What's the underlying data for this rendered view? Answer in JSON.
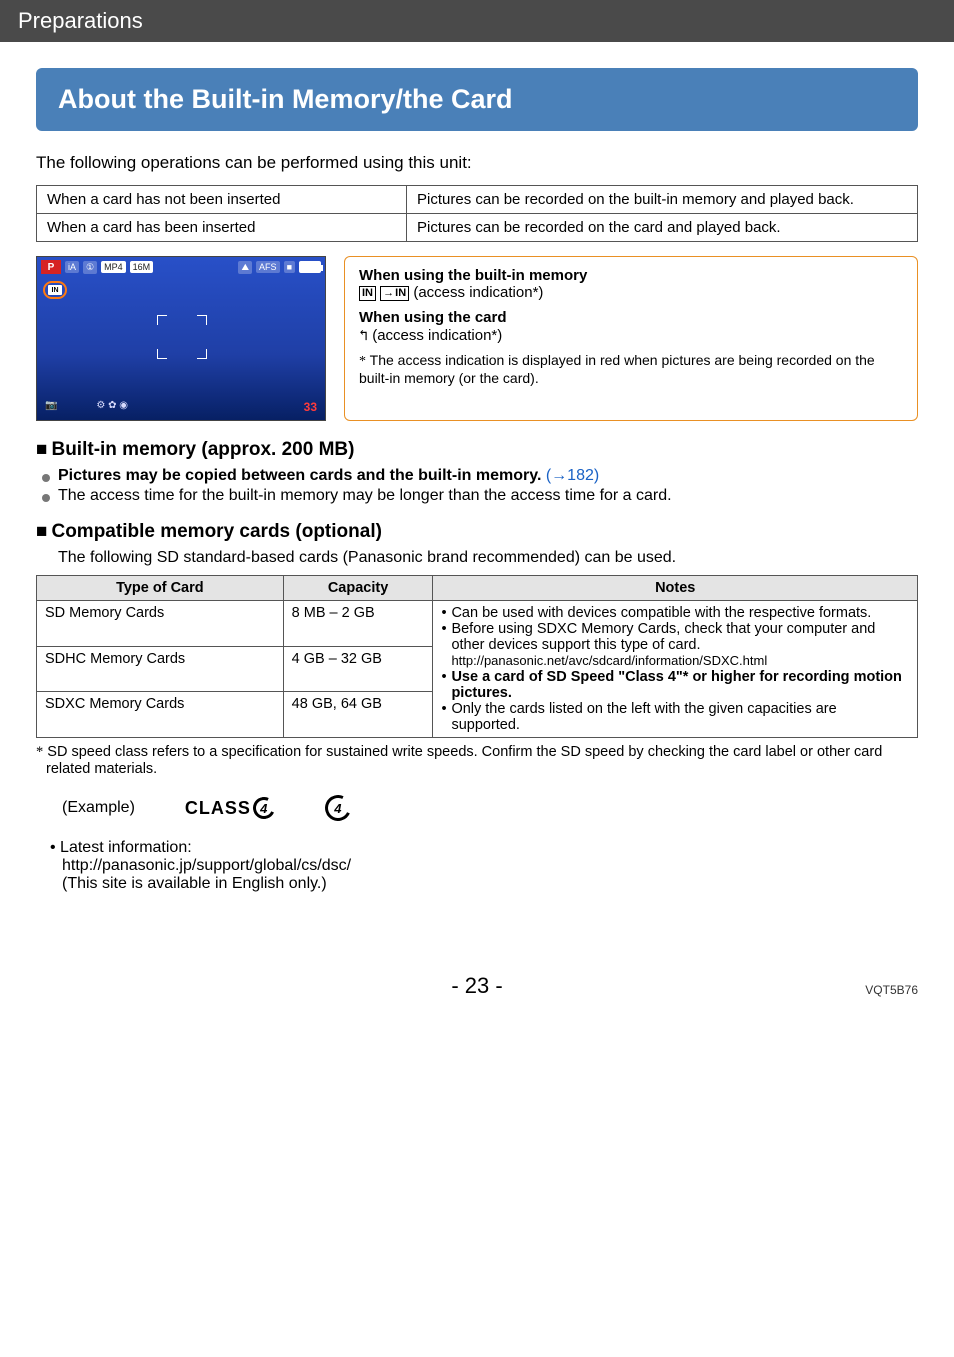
{
  "header": {
    "breadcrumb": "Preparations"
  },
  "title": "About the Built-in Memory/the Card",
  "intro": "The following operations can be performed using this unit:",
  "ops_table": [
    {
      "when": "When a card has not been inserted",
      "result": "Pictures can be recorded on the built-in memory and played back."
    },
    {
      "when": "When a card has been inserted",
      "result": "Pictures can be recorded on the card and played back."
    }
  ],
  "camera_preview": {
    "mode": "P",
    "top_chips": [
      "iA",
      "MP4",
      "16M"
    ],
    "right_chips": [
      "⛰",
      "AFS",
      "■"
    ],
    "memory_icon": "IN",
    "footer_left": "⚙ ✿ ◉",
    "footer_right": "33",
    "camera_icon": "📷"
  },
  "memory_box": {
    "builtin_title": "When using the built-in memory",
    "builtin_icons": {
      "in": "IN",
      "in_arrow": "IN"
    },
    "builtin_suffix": " (access indication*)",
    "card_title": "When using the card",
    "card_icon": "↰",
    "card_suffix": " (access indication*)",
    "star_note": "The access indication is displayed in red when pictures are being recorded on the built-in memory (or the card)."
  },
  "section_builtin": {
    "heading": "Built-in memory (approx. 200 MB)",
    "bullet_copy_prefix": "Pictures may be copied between cards and the built-in memory.",
    "bullet_copy_ref": " (→182)",
    "bullet_access": "The access time for the built-in memory may be longer than the access time for a card."
  },
  "section_compat": {
    "heading": "Compatible memory cards (optional)",
    "intro": "The following SD standard-based cards (Panasonic brand recommended) can be used.",
    "columns": {
      "type": "Type of Card",
      "capacity": "Capacity",
      "notes": "Notes"
    },
    "rows": [
      {
        "type": "SD Memory Cards",
        "capacity": "8 MB – 2 GB"
      },
      {
        "type": "SDHC Memory Cards",
        "capacity": "4 GB – 32 GB"
      },
      {
        "type": "SDXC Memory Cards",
        "capacity": "48 GB, 64 GB"
      }
    ],
    "notes": {
      "n1": "Can be used with devices compatible with the respective formats.",
      "n2_lead": "Before using SDXC Memory Cards, check that your computer and other devices support this type of card.",
      "n2_url": "http://panasonic.net/avc/sdcard/information/SDXC.html",
      "n3_bold": "Use a card of SD Speed \"Class 4\"* or higher for recording motion pictures.",
      "n4": "Only the cards listed on the left with the given capacities are supported."
    }
  },
  "footnote": "SD speed class refers to a specification for sustained write speeds. Confirm the SD speed by checking the card label or other card related materials.",
  "example": {
    "label": "(Example)",
    "class_text": "CLASS",
    "class_num": "4"
  },
  "latest": {
    "label": "Latest information:",
    "url": "http://panasonic.jp/support/global/cs/dsc/",
    "note": "(This site is available in English only.)"
  },
  "page": {
    "number": "- 23 -",
    "code": "VQT5B76"
  }
}
